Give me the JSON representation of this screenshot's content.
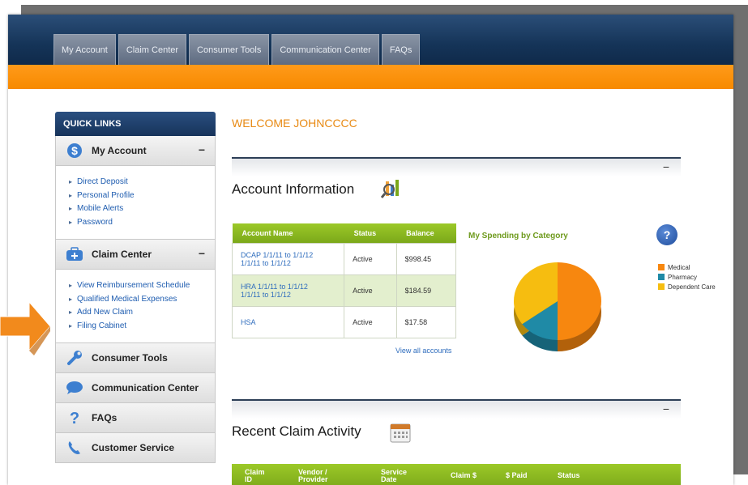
{
  "nav": {
    "tabs": [
      "My Account",
      "Claim Center",
      "Consumer Tools",
      "Communication Center",
      "FAQs"
    ]
  },
  "sidebar": {
    "header": "QUICK LINKS",
    "my_account": {
      "title": "My Account",
      "collapse": "−",
      "links": [
        "Direct Deposit",
        "Personal Profile",
        "Mobile Alerts",
        "Password"
      ]
    },
    "claim_center": {
      "title": "Claim Center",
      "collapse": "−",
      "links": [
        "View Reimbursement Schedule",
        "Qualified Medical Expenses",
        "Add New Claim",
        "Filing Cabinet"
      ]
    },
    "consumer_tools": "Consumer Tools",
    "communication_center": "Communication Center",
    "faqs": "FAQs",
    "customer_service": "Customer Service"
  },
  "main": {
    "welcome": "WELCOME JOHNCCCC",
    "collapse": "−",
    "account_info": {
      "title": "Account Information",
      "columns": [
        "Account Name",
        "Status",
        "Balance"
      ],
      "rows": [
        {
          "name_line1": "DCAP 1/1/11 to 1/1/12",
          "name_line2": "1/1/11 to 1/1/12",
          "status": "Active",
          "balance": "$998.45"
        },
        {
          "name_line1": "HRA 1/1/11 to 1/1/12",
          "name_line2": "1/1/11 to 1/1/12",
          "status": "Active",
          "balance": "$184.59"
        },
        {
          "name_line1": "HSA",
          "name_line2": "",
          "status": "Active",
          "balance": "$17.58"
        }
      ],
      "view_all": "View all accounts"
    },
    "spending": {
      "title": "My Spending by Category",
      "help": "?",
      "legend": [
        "Medical",
        "Pharmacy",
        "Dependent Care"
      ],
      "colors": [
        "#f7870f",
        "#1f8aa6",
        "#f6bd10"
      ],
      "shares": [
        0.5,
        0.15,
        0.35
      ]
    },
    "recent_claims": {
      "title": "Recent Claim Activity",
      "columns": {
        "claim_id_1": "Claim",
        "claim_id_2": "ID",
        "vendor_1": "Vendor /",
        "vendor_2": "Provider",
        "service_1": "Service",
        "service_2": "Date",
        "claim_amt": "Claim $",
        "paid": "$ Paid",
        "status": "Status"
      }
    }
  }
}
